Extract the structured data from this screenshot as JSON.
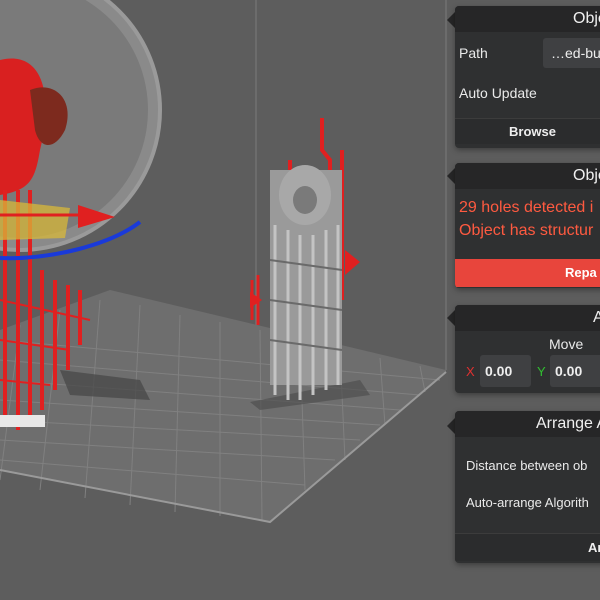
{
  "object_panel": {
    "title": "Obje",
    "path_label": "Path",
    "path_value": "…ed-bu",
    "auto_update_label": "Auto Update",
    "browse_label": "Browse"
  },
  "check_panel": {
    "title": "Obje",
    "error_1": "29 holes detected i",
    "error_2": "Object has structur",
    "repair_label": "Repa"
  },
  "transform_panel": {
    "title": "A",
    "move_label": "Move",
    "x_axis": "X",
    "y_axis": "Y",
    "x_value": "0.00",
    "y_value": "0.00"
  },
  "arrange_panel": {
    "title": "Arrange A",
    "distance_label": "Distance between ob",
    "algorithm_label": "Auto-arrange Algorith",
    "arrange_button": "Ar"
  },
  "colors": {
    "error_text": "#ff5a40",
    "repair_button": "#e8453c",
    "axis_x": "#e03030",
    "axis_y": "#30c030"
  }
}
